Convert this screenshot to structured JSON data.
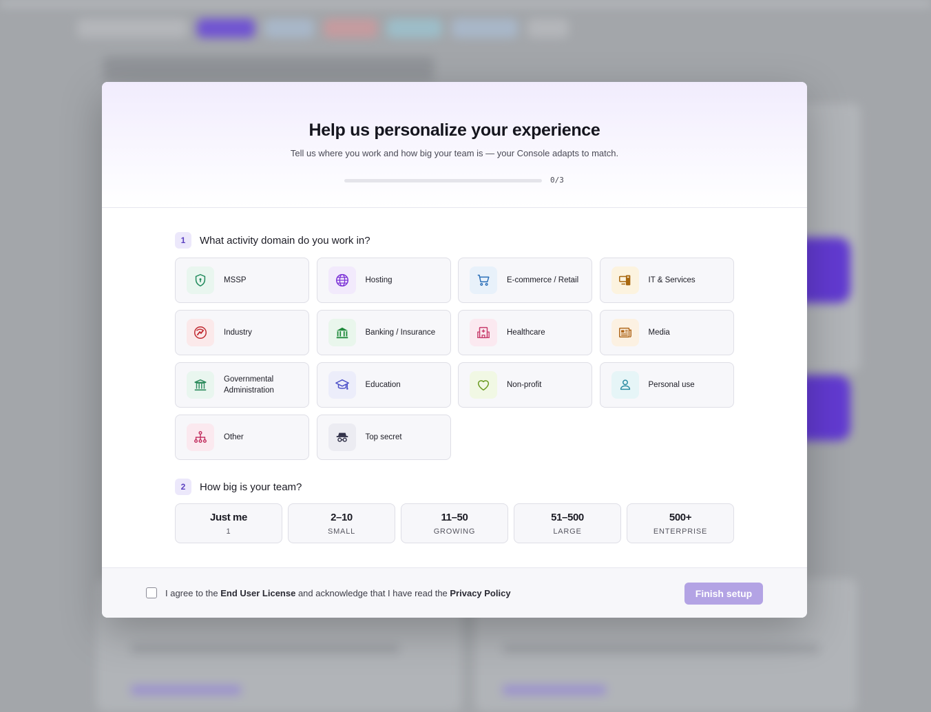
{
  "modal": {
    "title": "Help us personalize your experience",
    "subtitle": "Tell us where you work and how big your team is — your Console adapts to match.",
    "progress_label": "0/3",
    "progress_fraction": 0
  },
  "q1": {
    "number": "1",
    "title": "What activity domain do you work in?",
    "options": [
      {
        "label": "MSSP",
        "icon": "shield-icon",
        "color": "#1f8a5b",
        "bg": "#e9f6ef"
      },
      {
        "label": "Hosting",
        "icon": "globe-icon",
        "color": "#7a2fd6",
        "bg": "#f2eafc"
      },
      {
        "label": "E-commerce / Retail",
        "icon": "cart-icon",
        "color": "#2a6fb8",
        "bg": "#e8f1fa"
      },
      {
        "label": "IT & Services",
        "icon": "devices-icon",
        "color": "#a8670f",
        "bg": "#fcf3df"
      },
      {
        "label": "Industry",
        "icon": "industry-icon",
        "color": "#c0282f",
        "bg": "#fbe9ea"
      },
      {
        "label": "Banking / Insurance",
        "icon": "bank-icon",
        "color": "#1f8a3b",
        "bg": "#e9f6ec"
      },
      {
        "label": "Healthcare",
        "icon": "hospital-icon",
        "color": "#c73a6a",
        "bg": "#fbe9f0"
      },
      {
        "label": "Media",
        "icon": "newspaper-icon",
        "color": "#b0671b",
        "bg": "#fcf1e2"
      },
      {
        "label": "Governmental Administration",
        "icon": "government-icon",
        "color": "#2a8a5b",
        "bg": "#e9f6ef"
      },
      {
        "label": "Education",
        "icon": "graduation-cap-icon",
        "color": "#4b4fc8",
        "bg": "#ecedfa"
      },
      {
        "label": "Non-profit",
        "icon": "heart-icon",
        "color": "#6a9a1f",
        "bg": "#f1f8e4"
      },
      {
        "label": "Personal use",
        "icon": "user-icon",
        "color": "#2a8aa0",
        "bg": "#e6f5f7"
      },
      {
        "label": "Other",
        "icon": "hierarchy-icon",
        "color": "#c0285a",
        "bg": "#fbe9ef"
      },
      {
        "label": "Top secret",
        "icon": "spy-icon",
        "color": "#33334a",
        "bg": "#ececf2"
      }
    ]
  },
  "q2": {
    "number": "2",
    "title": "How big is your team?",
    "options": [
      {
        "value": "Just me",
        "caption": "1"
      },
      {
        "value": "2–10",
        "caption": "SMALL"
      },
      {
        "value": "11–50",
        "caption": "GROWING"
      },
      {
        "value": "51–500",
        "caption": "LARGE"
      },
      {
        "value": "500+",
        "caption": "ENTERPRISE"
      }
    ]
  },
  "footer": {
    "agree_prefix": "I agree to the ",
    "eula_link": "End User License",
    "agree_middle": " and acknowledge that I have read the ",
    "privacy_link": "Privacy Policy",
    "finish_label": "Finish setup"
  }
}
